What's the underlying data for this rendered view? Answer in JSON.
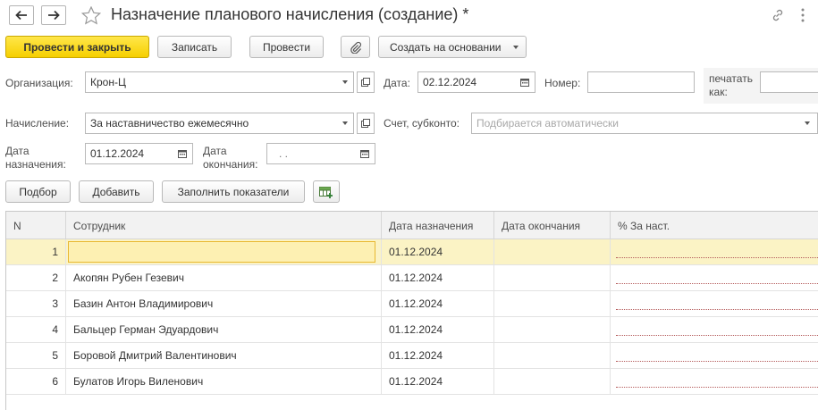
{
  "window": {
    "title": "Назначение планового начисления (создание) *"
  },
  "toolbar": {
    "post_close": "Провести и закрыть",
    "save": "Записать",
    "post": "Провести",
    "create_based": "Создать на основании"
  },
  "form": {
    "org_label": "Организация:",
    "org_value": "Крон-Ц",
    "date_label": "Дата:",
    "date_value": "02.12.2024",
    "number_label": "Номер:",
    "number_value": "",
    "print_as_label": "печатать как:",
    "print_as_value": "",
    "accrual_label": "Начисление:",
    "accrual_value": "За наставничество ежемесячно",
    "account_label": "Счет, субконто:",
    "account_placeholder": "Подбирается автоматически",
    "assign_date_label": "Дата назначения:",
    "assign_date_value": "01.12.2024",
    "end_date_label": "Дата окончания:",
    "end_date_value": " .  ."
  },
  "table_toolbar": {
    "select": "Подбор",
    "add": "Добавить",
    "fill": "Заполнить показатели"
  },
  "table": {
    "columns": [
      "N",
      "Сотрудник",
      "Дата назначения",
      "Дата окончания",
      "%  За наст."
    ],
    "rows": [
      {
        "n": "1",
        "employee": "",
        "assign": "01.12.2024",
        "end": "",
        "pct": ""
      },
      {
        "n": "2",
        "employee": "Акопян Рубен Гезевич",
        "assign": "01.12.2024",
        "end": "",
        "pct": ""
      },
      {
        "n": "3",
        "employee": "Базин Антон Владимирович",
        "assign": "01.12.2024",
        "end": "",
        "pct": ""
      },
      {
        "n": "4",
        "employee": "Бальцер Герман Эдуардович",
        "assign": "01.12.2024",
        "end": "",
        "pct": ""
      },
      {
        "n": "5",
        "employee": "Боровой Дмитрий Валентинович",
        "assign": "01.12.2024",
        "end": "",
        "pct": ""
      },
      {
        "n": "6",
        "employee": "Булатов Игорь Виленович",
        "assign": "01.12.2024",
        "end": "",
        "pct": ""
      }
    ]
  },
  "colors": {
    "primary_button": "#f6cf00",
    "selected_row": "#fbf3c5",
    "active_cell_border": "#e8b830"
  }
}
